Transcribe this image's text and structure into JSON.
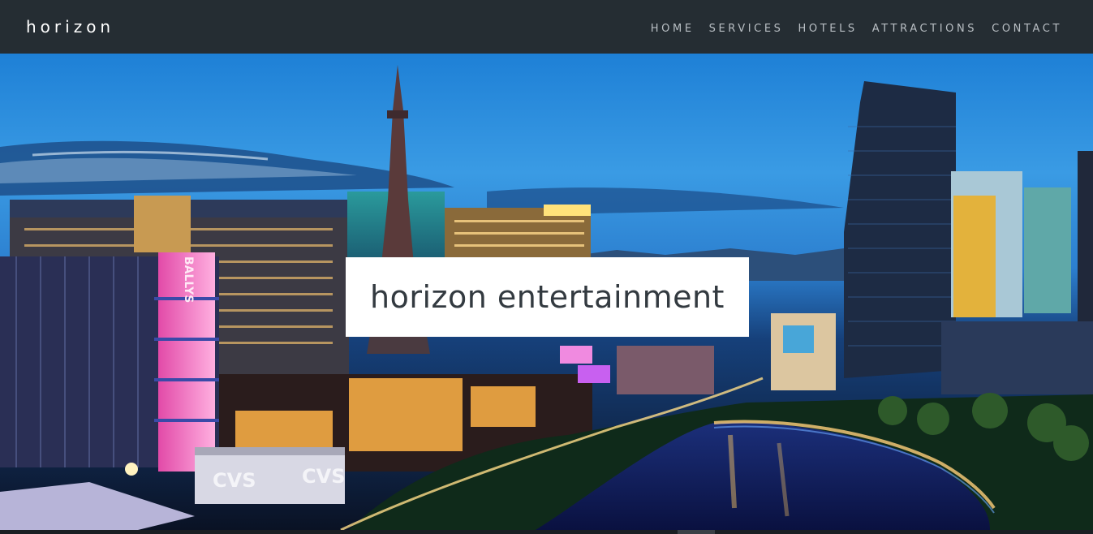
{
  "brand": {
    "name": "horizon"
  },
  "nav": {
    "items": [
      {
        "label": "HOME"
      },
      {
        "label": "SERVICES"
      },
      {
        "label": "HOTELS"
      },
      {
        "label": "ATTRACTIONS"
      },
      {
        "label": "CONTACT"
      }
    ]
  },
  "hero": {
    "title": "horizon entertainment",
    "signs": {
      "ballys": "BALLYS",
      "cvs_left": "CVS",
      "cvs_right": "CVS"
    }
  },
  "colors": {
    "navbar_bg": "#252d33",
    "nav_text": "#b9bfc4",
    "brand_text": "#ffffff",
    "title_box_bg": "#ffffff",
    "title_text": "#333a40"
  }
}
